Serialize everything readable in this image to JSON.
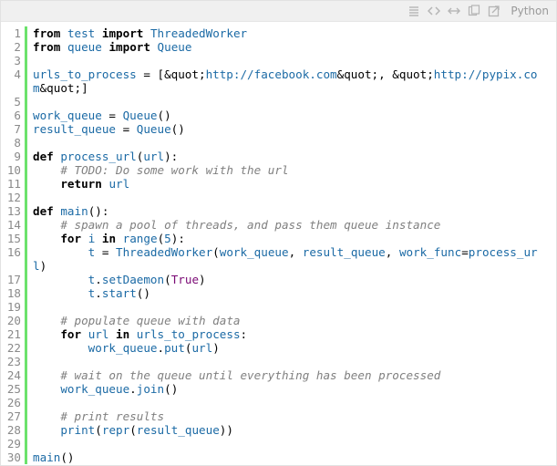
{
  "toolbar": {
    "language": "Python",
    "icons": [
      "view-source-icon",
      "expand-code-icon",
      "toggle-wrap-icon",
      "copy-icon",
      "popup-icon"
    ]
  },
  "colors": {
    "gutter_bar": "#6ce26c",
    "identifier": "#1b6aa5",
    "comment": "#808080",
    "constant": "#7a0874"
  },
  "lines": [
    {
      "n": "1",
      "t": [
        {
          "c": "kw",
          "v": "from"
        },
        {
          "c": "plain",
          "v": " "
        },
        {
          "c": "id",
          "v": "test"
        },
        {
          "c": "plain",
          "v": " "
        },
        {
          "c": "kw",
          "v": "import"
        },
        {
          "c": "plain",
          "v": " "
        },
        {
          "c": "id",
          "v": "ThreadedWorker"
        }
      ]
    },
    {
      "n": "2",
      "t": [
        {
          "c": "kw",
          "v": "from"
        },
        {
          "c": "plain",
          "v": " "
        },
        {
          "c": "id",
          "v": "queue"
        },
        {
          "c": "plain",
          "v": " "
        },
        {
          "c": "kw",
          "v": "import"
        },
        {
          "c": "plain",
          "v": " "
        },
        {
          "c": "id",
          "v": "Queue"
        }
      ]
    },
    {
      "n": "3",
      "t": []
    },
    {
      "n": "4",
      "t": [
        {
          "c": "id",
          "v": "urls_to_process"
        },
        {
          "c": "plain",
          "v": " = [&quot;"
        },
        {
          "c": "id",
          "v": "http://facebook.com"
        },
        {
          "c": "plain",
          "v": "&quot;, &quot;"
        },
        {
          "c": "id",
          "v": "http://pypix.co"
        }
      ]
    },
    {
      "n": "",
      "t": [
        {
          "c": "id",
          "v": "m"
        },
        {
          "c": "plain",
          "v": "&quot;]"
        }
      ]
    },
    {
      "n": "5",
      "t": []
    },
    {
      "n": "6",
      "t": [
        {
          "c": "id",
          "v": "work_queue"
        },
        {
          "c": "plain",
          "v": " = "
        },
        {
          "c": "id",
          "v": "Queue"
        },
        {
          "c": "plain",
          "v": "()"
        }
      ]
    },
    {
      "n": "7",
      "t": [
        {
          "c": "id",
          "v": "result_queue"
        },
        {
          "c": "plain",
          "v": " = "
        },
        {
          "c": "id",
          "v": "Queue"
        },
        {
          "c": "plain",
          "v": "()"
        }
      ]
    },
    {
      "n": "8",
      "t": []
    },
    {
      "n": "9",
      "t": [
        {
          "c": "kw",
          "v": "def"
        },
        {
          "c": "plain",
          "v": " "
        },
        {
          "c": "id",
          "v": "process_url"
        },
        {
          "c": "plain",
          "v": "("
        },
        {
          "c": "id",
          "v": "url"
        },
        {
          "c": "plain",
          "v": "):"
        }
      ]
    },
    {
      "n": "10",
      "t": [
        {
          "c": "plain",
          "v": "    "
        },
        {
          "c": "cm",
          "v": "# TODO: Do some work with the url"
        }
      ]
    },
    {
      "n": "11",
      "t": [
        {
          "c": "plain",
          "v": "    "
        },
        {
          "c": "kw",
          "v": "return"
        },
        {
          "c": "plain",
          "v": " "
        },
        {
          "c": "id",
          "v": "url"
        }
      ]
    },
    {
      "n": "12",
      "t": []
    },
    {
      "n": "13",
      "t": [
        {
          "c": "kw",
          "v": "def"
        },
        {
          "c": "plain",
          "v": " "
        },
        {
          "c": "id",
          "v": "main"
        },
        {
          "c": "plain",
          "v": "():"
        }
      ]
    },
    {
      "n": "14",
      "t": [
        {
          "c": "plain",
          "v": "    "
        },
        {
          "c": "cm",
          "v": "# spawn a pool of threads, and pass them queue instance"
        }
      ]
    },
    {
      "n": "15",
      "t": [
        {
          "c": "plain",
          "v": "    "
        },
        {
          "c": "kw",
          "v": "for"
        },
        {
          "c": "plain",
          "v": " "
        },
        {
          "c": "id",
          "v": "i"
        },
        {
          "c": "plain",
          "v": " "
        },
        {
          "c": "kw",
          "v": "in"
        },
        {
          "c": "plain",
          "v": " "
        },
        {
          "c": "id",
          "v": "range"
        },
        {
          "c": "plain",
          "v": "("
        },
        {
          "c": "id",
          "v": "5"
        },
        {
          "c": "plain",
          "v": "):"
        }
      ]
    },
    {
      "n": "16",
      "t": [
        {
          "c": "plain",
          "v": "        "
        },
        {
          "c": "id",
          "v": "t"
        },
        {
          "c": "plain",
          "v": " = "
        },
        {
          "c": "id",
          "v": "ThreadedWorker"
        },
        {
          "c": "plain",
          "v": "("
        },
        {
          "c": "id",
          "v": "work_queue"
        },
        {
          "c": "plain",
          "v": ", "
        },
        {
          "c": "id",
          "v": "result_queue"
        },
        {
          "c": "plain",
          "v": ", "
        },
        {
          "c": "id",
          "v": "work_func"
        },
        {
          "c": "plain",
          "v": "="
        },
        {
          "c": "id",
          "v": "process_ur"
        }
      ]
    },
    {
      "n": "",
      "t": [
        {
          "c": "id",
          "v": "l"
        },
        {
          "c": "plain",
          "v": ")"
        }
      ]
    },
    {
      "n": "17",
      "t": [
        {
          "c": "plain",
          "v": "        "
        },
        {
          "c": "id",
          "v": "t"
        },
        {
          "c": "plain",
          "v": "."
        },
        {
          "c": "id",
          "v": "setDaemon"
        },
        {
          "c": "plain",
          "v": "("
        },
        {
          "c": "kc",
          "v": "True"
        },
        {
          "c": "plain",
          "v": ")"
        }
      ]
    },
    {
      "n": "18",
      "t": [
        {
          "c": "plain",
          "v": "        "
        },
        {
          "c": "id",
          "v": "t"
        },
        {
          "c": "plain",
          "v": "."
        },
        {
          "c": "id",
          "v": "start"
        },
        {
          "c": "plain",
          "v": "()"
        }
      ]
    },
    {
      "n": "19",
      "t": []
    },
    {
      "n": "20",
      "t": [
        {
          "c": "plain",
          "v": "    "
        },
        {
          "c": "cm",
          "v": "# populate queue with data"
        }
      ]
    },
    {
      "n": "21",
      "t": [
        {
          "c": "plain",
          "v": "    "
        },
        {
          "c": "kw",
          "v": "for"
        },
        {
          "c": "plain",
          "v": " "
        },
        {
          "c": "id",
          "v": "url"
        },
        {
          "c": "plain",
          "v": " "
        },
        {
          "c": "kw",
          "v": "in"
        },
        {
          "c": "plain",
          "v": " "
        },
        {
          "c": "id",
          "v": "urls_to_process"
        },
        {
          "c": "plain",
          "v": ":"
        }
      ]
    },
    {
      "n": "22",
      "t": [
        {
          "c": "plain",
          "v": "        "
        },
        {
          "c": "id",
          "v": "work_queue"
        },
        {
          "c": "plain",
          "v": "."
        },
        {
          "c": "id",
          "v": "put"
        },
        {
          "c": "plain",
          "v": "("
        },
        {
          "c": "id",
          "v": "url"
        },
        {
          "c": "plain",
          "v": ")"
        }
      ]
    },
    {
      "n": "23",
      "t": []
    },
    {
      "n": "24",
      "t": [
        {
          "c": "plain",
          "v": "    "
        },
        {
          "c": "cm",
          "v": "# wait on the queue until everything has been processed"
        }
      ]
    },
    {
      "n": "25",
      "t": [
        {
          "c": "plain",
          "v": "    "
        },
        {
          "c": "id",
          "v": "work_queue"
        },
        {
          "c": "plain",
          "v": "."
        },
        {
          "c": "id",
          "v": "join"
        },
        {
          "c": "plain",
          "v": "()"
        }
      ]
    },
    {
      "n": "26",
      "t": []
    },
    {
      "n": "27",
      "t": [
        {
          "c": "plain",
          "v": "    "
        },
        {
          "c": "cm",
          "v": "# print results"
        }
      ]
    },
    {
      "n": "28",
      "t": [
        {
          "c": "plain",
          "v": "    "
        },
        {
          "c": "id",
          "v": "print"
        },
        {
          "c": "plain",
          "v": "("
        },
        {
          "c": "id",
          "v": "repr"
        },
        {
          "c": "plain",
          "v": "("
        },
        {
          "c": "id",
          "v": "result_queue"
        },
        {
          "c": "plain",
          "v": "))"
        }
      ]
    },
    {
      "n": "29",
      "t": []
    },
    {
      "n": "30",
      "t": [
        {
          "c": "id",
          "v": "main"
        },
        {
          "c": "plain",
          "v": "()"
        }
      ]
    }
  ]
}
